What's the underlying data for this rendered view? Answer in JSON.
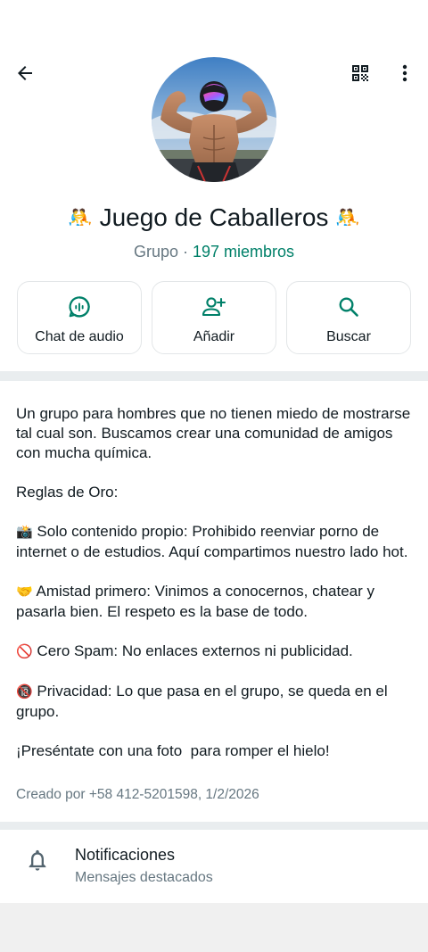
{
  "header": {
    "title": "Juego de Caballeros",
    "title_emoji": "🤼",
    "subtitle_type": "Grupo",
    "subtitle_sep": " · ",
    "members": "197 miembros"
  },
  "icons": {
    "back": "arrow-back-icon",
    "qr": "qr-code-icon",
    "menu": "more-vert-icon",
    "audio_chat": "audio-chat-icon",
    "add_person": "add-person-icon",
    "search": "search-icon",
    "bell": "bell-icon"
  },
  "actions": {
    "audio_label": "Chat de audio",
    "add_label": "Añadir",
    "search_label": "Buscar"
  },
  "description": {
    "paragraph1": "Un grupo para hombres que no tienen miedo de mostrarse tal cual son. Buscamos crear una comunidad de amigos con mucha química.",
    "rules_title": "Reglas de Oro:",
    "rule1_emoji": "📸",
    "rule1": "Solo contenido propio: Prohibido reenviar porno de internet o de estudios. Aquí compartimos nuestro lado hot.",
    "rule2_emoji": "🤝",
    "rule2": "Amistad primero: Vinimos a conocernos, chatear y pasarla bien. El respeto es la base de todo.",
    "rule3_emoji": "🚫",
    "rule3": "Cero Spam: No enlaces externos ni publicidad.",
    "rule4_emoji": "🔞",
    "rule4": "Privacidad: Lo que pasa en el grupo, se queda en el grupo.",
    "closing": "¡Preséntate con una foto  para romper el hielo!",
    "created": "Creado por +58 412-5201598, 1/2/2026"
  },
  "notifications": {
    "title": "Notificaciones",
    "subtitle": "Mensajes destacados"
  },
  "colors": {
    "accent": "#008069",
    "secondary_text": "#667781",
    "primary_text": "#111b21"
  }
}
